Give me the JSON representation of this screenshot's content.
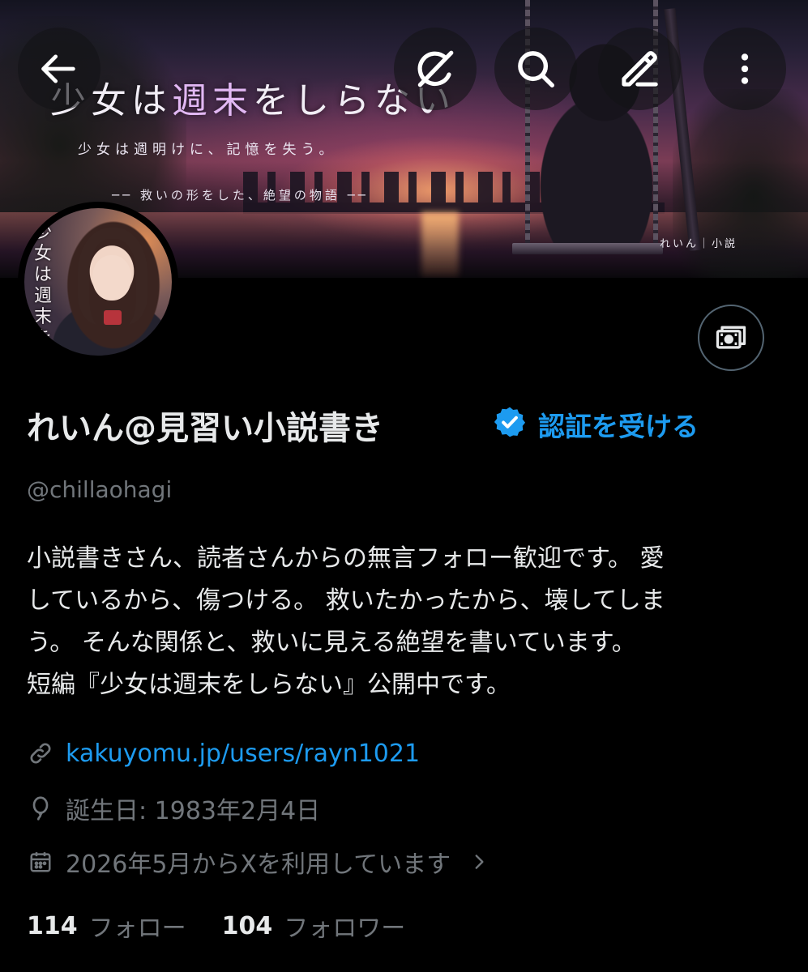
{
  "banner": {
    "title_part1": "少女は",
    "title_accent": "週末",
    "title_part2": "をしらない",
    "tagline": "少女は週明けに、記憶を失う。",
    "subtitle": "── 救いの形をした、絶望の物語 ──",
    "credit": "れいん｜小説"
  },
  "avatar": {
    "text": "少女は週末をしら"
  },
  "top_bar": {
    "buttons": [
      "back-arrow-icon",
      "grok-icon",
      "search-icon",
      "edit-icon",
      "more-vertical-icon"
    ]
  },
  "profile": {
    "display_name": "れいん@見習い小説書き",
    "get_verified": "認証を受ける",
    "handle": "@chillaohagi",
    "bio": "小説書きさん、読者さんからの無言フォロー歓迎です。 愛\nしているから、傷つける。 救いたかったから、壊してしま\nう。 そんな関係と、救いに見える絶望を書いています。\n短編『少女は週末をしらない』公開中です。",
    "link": "kakuyomu.jp/users/rayn1021",
    "birthday": "誕生日: 1983年2月4日",
    "joined": "2026年5月からXを利用しています"
  },
  "stats": {
    "following_count": "114",
    "following_label": "フォロー",
    "followers_count": "104",
    "followers_label": "フォロワー"
  },
  "colors": {
    "background": "#000000",
    "text_primary": "#e7e9ea",
    "text_secondary": "#71767b",
    "accent": "#1d9bf0",
    "border": "#536471"
  }
}
